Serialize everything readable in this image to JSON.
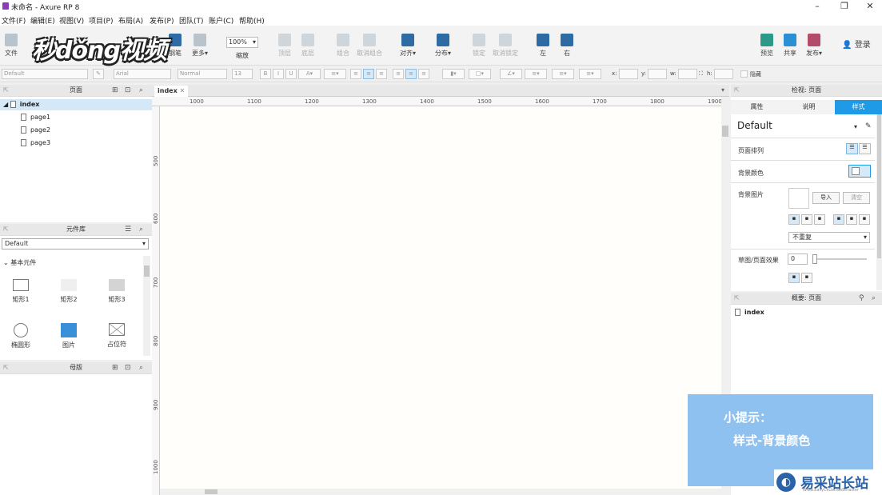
{
  "window": {
    "title": "未命名 - Axure RP 8"
  },
  "menu": [
    "文件(F)",
    "编辑(E)",
    "视图(V)",
    "项目(P)",
    "布局(A)",
    "发布(P)",
    "团队(T)",
    "账户(C)",
    "帮助(H)"
  ],
  "toolbar": {
    "file_label": "文件",
    "pen_label": "钢笔",
    "more_label": "更多▾",
    "zoom_value": "100%",
    "zoom_label": "缩放",
    "top_label": "顶层",
    "bottom_label": "底层",
    "group_label": "组合",
    "ungroup_label": "取消组合",
    "align_label": "对齐▾",
    "distribute_label": "分布▾",
    "lock_label": "锁定",
    "unlock_label": "取消锁定",
    "left_label": "左",
    "right_label": "右",
    "preview_label": "预览",
    "share_label": "共享",
    "publish_label": "发布▾",
    "login_label": "登录"
  },
  "watermark": "秒dǒng视频",
  "format": {
    "style": "Default",
    "font": "Arial",
    "weight": "Normal",
    "size": "13",
    "x_label": "x:",
    "y_label": "y:",
    "w_label": "w:",
    "h_label": "h:",
    "hide_label": "隐藏"
  },
  "pages_panel": {
    "title": "页面",
    "items": [
      "index",
      "page1",
      "page2",
      "page3"
    ]
  },
  "library_panel": {
    "title": "元件库",
    "selected": "Default",
    "section": "基本元件",
    "widgets": [
      "矩形1",
      "矩形2",
      "矩形3",
      "椭圆形",
      "图片",
      "占位符"
    ]
  },
  "masters_panel": {
    "title": "母版"
  },
  "canvas": {
    "tab": "index",
    "h_ruler": [
      "1000",
      "1100",
      "1200",
      "1300",
      "1400",
      "1500",
      "1600",
      "1700",
      "1800",
      "1900"
    ],
    "v_ruler": [
      "500",
      "600",
      "700",
      "800",
      "900",
      "1000"
    ]
  },
  "inspector": {
    "title": "检视: 页面",
    "tabs": [
      "属性",
      "说明",
      "样式"
    ],
    "style_name": "Default",
    "page_align_label": "页面排列",
    "bg_color_label": "背景颜色",
    "bg_image_label": "背景图片",
    "import_label": "导入",
    "clear_label": "清空",
    "repeat_value": "不重复",
    "sketch_label": "草图/页面效果",
    "sketch_value": "0"
  },
  "outline_panel": {
    "title": "概要: 页面",
    "item": "index"
  },
  "tip": {
    "line1": "小提示：",
    "line2": "样式-背景颜色"
  },
  "brand": {
    "name": "易采站长站",
    "sub": "Www.EasyCkGw.Webmaster"
  }
}
